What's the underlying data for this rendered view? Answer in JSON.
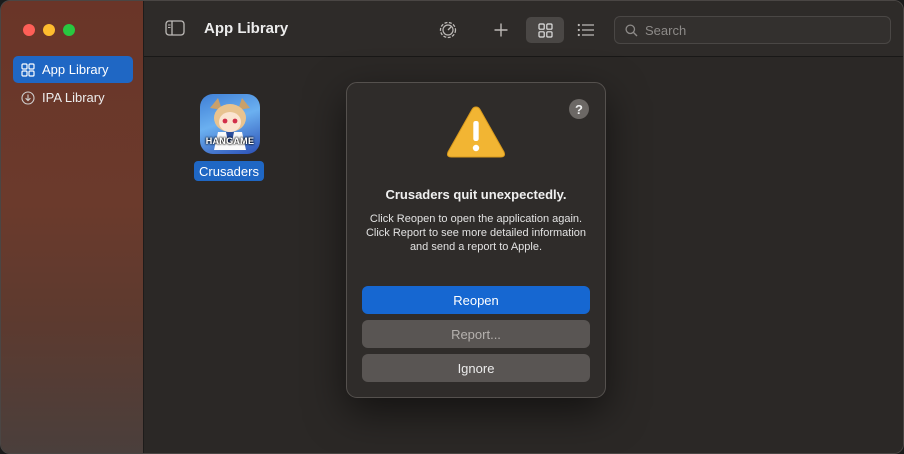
{
  "window": {
    "title": "App Library"
  },
  "sidebar": {
    "items": [
      {
        "label": "App Library",
        "icon": "grid-icon",
        "selected": true
      },
      {
        "label": "IPA Library",
        "icon": "download-circle-icon",
        "selected": false
      }
    ]
  },
  "toolbar": {
    "title": "App Library",
    "search_placeholder": "Search",
    "view_mode": "grid"
  },
  "library": {
    "apps": [
      {
        "name": "Crusaders",
        "icon_text": "HANGAME"
      }
    ]
  },
  "dialog": {
    "help": "?",
    "title": "Crusaders quit unexpectedly.",
    "message": "Click Reopen to open the application again. Click Report to see more detailed information and send a report to Apple.",
    "buttons": {
      "reopen": "Reopen",
      "report": "Report...",
      "ignore": "Ignore"
    }
  },
  "colors": {
    "accent": "#1667d1",
    "warning": "#f2b533"
  }
}
